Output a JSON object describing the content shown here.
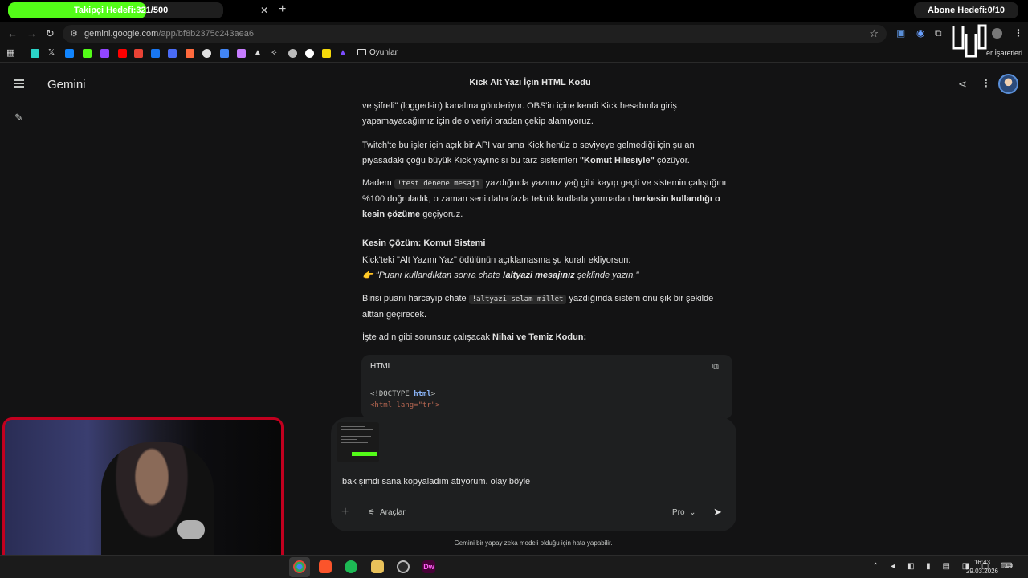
{
  "browser": {
    "tab_follow_goal": "Takipçi Hedefi:321/500",
    "tab_follow_progress": 0.642,
    "tab_subscriber_goal": "Abone Hedefi:0/10",
    "url_domain": "gemini.google.com",
    "url_path": "/app/bf8b2375c243aea6",
    "bookmark_folder": "Oyunlar",
    "bookmark_other": "er İşaretleri",
    "accent_color": "#53fc18"
  },
  "gemini": {
    "brand": "Gemini",
    "chat_title": "Kick Alt Yazı İçin HTML Kodu",
    "p1": "ve şifreli\" (logged-in) kanalına gönderiyor. OBS'in içine kendi Kick hesabınla giriş yapamayacağımız için de o veriyi oradan çekip alamıyoruz.",
    "p2_a": "Twitch'te bu işler için açık bir API var ama Kick henüz o seviyeye gelmediği için şu an piyasadaki çoğu büyük Kick yayıncısı bu tarz sistemleri ",
    "p2_b": "\"Komut Hilesiyle\"",
    "p2_c": " çözüyor.",
    "p3_a": "Madem ",
    "p3_code": "!test deneme mesajı",
    "p3_b": " yazdığında yazımız yağ gibi kayıp geçti ve sistemin çalıştığını %100 doğruladık, o zaman seni daha fazla teknik kodlarla yormadan ",
    "p3_c": "herkesin kullandığı o kesin çözüme",
    "p3_d": " geçiyoruz.",
    "heading": "Kesin Çözüm: Komut Sistemi",
    "p4": "Kick'teki \"Alt Yazını Yaz\" ödülünün açıklamasına şu kuralı ekliyorsun:",
    "quote_emoji": "👉",
    "quote_a": "\"Puanı kullandıktan sonra chate ",
    "quote_b": "!altyazi mesajınız",
    "quote_c": " şeklinde yazın.\"",
    "p5_a": "Birisi puanı harcayıp chate ",
    "p5_code": "!altyazi selam millet",
    "p5_b": " yazdığında sistem onu şık bir şekilde alttan geçirecek.",
    "p6_a": "İşte adın gibi sorunsuz çalışacak ",
    "p6_b": "Nihai ve Temiz Kodun:",
    "code_lang": "HTML",
    "code_line1_a": "<!DOCTYPE ",
    "code_line1_b": "html",
    "code_line1_c": ">",
    "code_line2": "<html lang=\"tr\">",
    "input_text": "bak şimdi sana kopyaladım atıyorum. olay böyle",
    "tools_label": "Araçlar",
    "mode_label": "Pro",
    "disclaimer": "Gemini bir yapay zeka modeli olduğu için hata yapabilir."
  },
  "taskbar": {
    "time": "16:43",
    "date": "29.03.2026"
  },
  "icons": [
    "back-icon",
    "forward-icon",
    "reload-icon",
    "star-icon",
    "menu-icon",
    "new-chat-icon",
    "share-icon",
    "more-icon",
    "copy-icon",
    "plus-icon",
    "tools-icon",
    "chevron-down-icon",
    "send-icon"
  ]
}
